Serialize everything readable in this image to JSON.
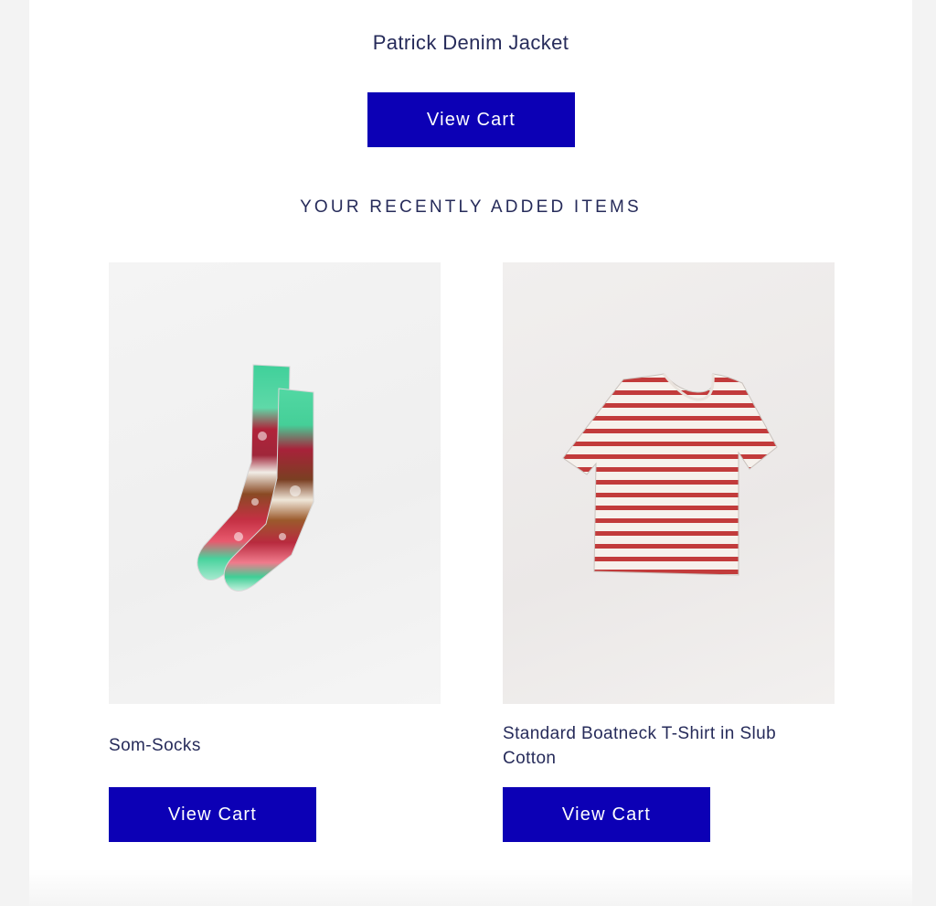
{
  "hero": {
    "product_name": "Patrick Denim Jacket",
    "button_label": "View Cart"
  },
  "recent": {
    "heading": "YOUR RECENTLY ADDED ITEMS",
    "items": [
      {
        "name": "Som-Socks",
        "image_icon": "tie-dye-socks-image",
        "button_label": "View Cart"
      },
      {
        "name": "Standard Boatneck T-Shirt in Slub Cotton",
        "image_icon": "striped-tshirt-image",
        "button_label": "View Cart"
      }
    ]
  },
  "colors": {
    "accent": "#0c00b5",
    "text": "#262b5a",
    "background": "#ffffff",
    "page_background": "#f3f3f3"
  }
}
